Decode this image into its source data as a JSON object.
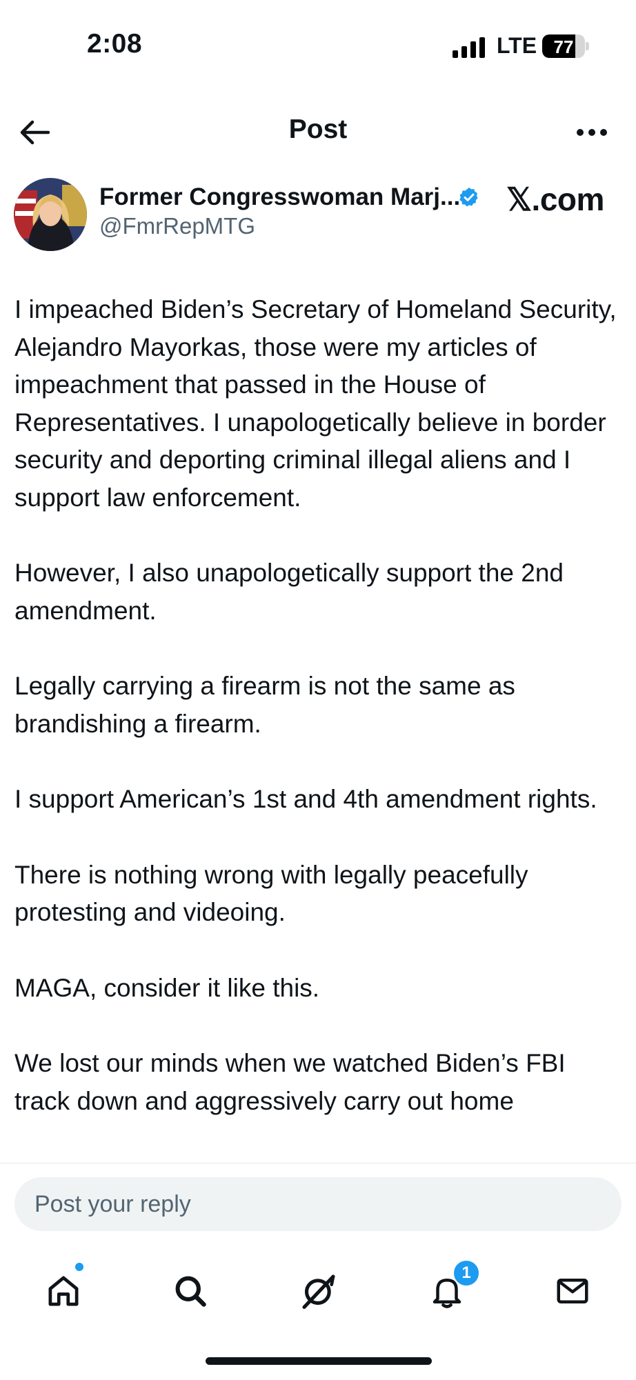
{
  "status_bar": {
    "time": "2:08",
    "network": "LTE",
    "battery": "77",
    "battery_level": 0.77
  },
  "header": {
    "title": "Post"
  },
  "post": {
    "author_name": "Former Congresswoman Marj...",
    "author_handle": "@FmrRepMTG",
    "verified": true,
    "source_label": "𝕏.com",
    "paragraphs": [
      "I impeached Biden’s Secretary of Homeland Security, Alejandro Mayorkas, those were my articles of impeachment that passed in the House of Representatives. I unapologetically believe in border security and deporting criminal illegal aliens and I support law enforcement.",
      "However, I also unapologetically support the 2nd amendment.",
      "Legally carrying a firearm is not the same as brandishing a firearm.",
      "I support American’s 1st and 4th amendment rights.",
      "There is nothing wrong with legally peacefully protesting and videoing.",
      "MAGA, consider it like this.",
      "We lost our minds when we watched Biden’s FBI track down and aggressively carry out home"
    ]
  },
  "reply": {
    "placeholder": "Post your reply"
  },
  "tab_bar": {
    "items": [
      "home-icon",
      "search-icon",
      "grok-icon",
      "bell-icon",
      "mail-icon"
    ],
    "notifications_badge": "1"
  },
  "colors": {
    "accent": "#1d9bf0",
    "text": "#0f1419",
    "secondary_text": "#536471",
    "input_bg": "#eff3f4"
  }
}
